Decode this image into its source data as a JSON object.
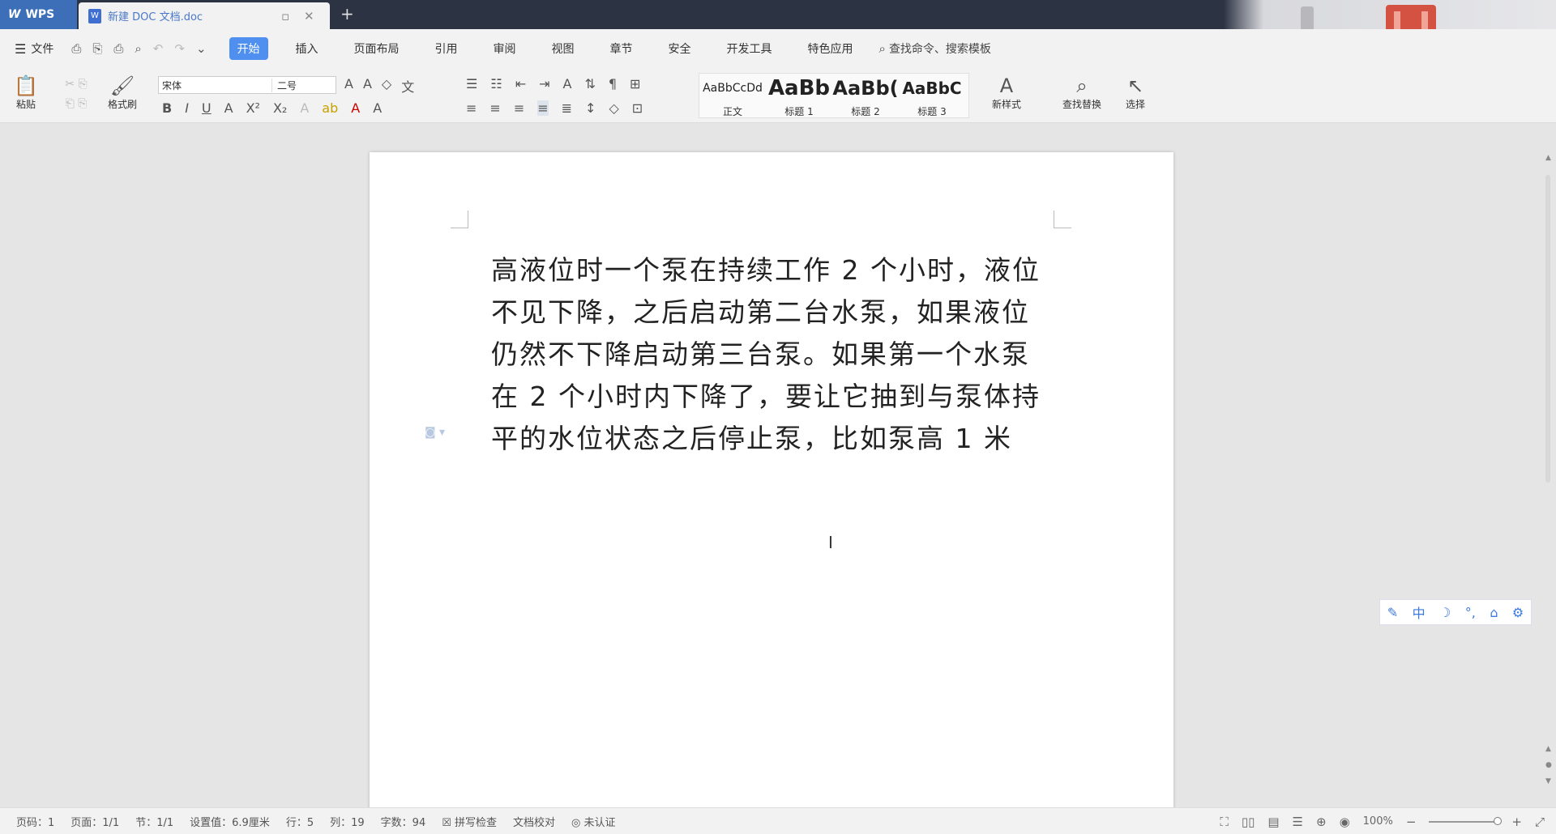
{
  "titlebar": {
    "app_name": "WPS",
    "doc_tab": "新建 DOC 文档.doc",
    "new_tab": "+"
  },
  "menubar": {
    "file_label": "文件",
    "tabs": [
      "开始",
      "插入",
      "页面布局",
      "引用",
      "审阅",
      "视图",
      "章节",
      "安全",
      "开发工具",
      "特色应用"
    ],
    "active_tab": "开始",
    "search_label": "查找命令、搜索模板"
  },
  "ribbon": {
    "paste_label": "粘贴",
    "format_painter_label": "格式刷",
    "font_name": "宋体",
    "font_size": "二号",
    "styles": [
      {
        "preview": "AaBbCcDd",
        "label": "正文"
      },
      {
        "preview": "AaBb",
        "label": "标题 1"
      },
      {
        "preview": "AaBb(",
        "label": "标题 2"
      },
      {
        "preview": "AaBbC",
        "label": "标题 3"
      }
    ],
    "new_style_label": "新样式",
    "find_replace_label": "查找替换",
    "select_label": "选择"
  },
  "document": {
    "lines": [
      "高液位时一个泵在持续工作 2 个小时，液位",
      "不见下降，之后启动第二台水泵，如果液位",
      "仍然不下降启动第三台泵。如果第一个水泵",
      "在 2 个小时内下降了，要让它抽到与泵体持",
      "平的水位状态之后停止泵，比如泵高 1 米"
    ]
  },
  "statusbar": {
    "page_num": "页码：1",
    "pages": "页面：1/1",
    "section": "节：1/1",
    "position": "设置值：6.9厘米",
    "row": "行：5",
    "col": "列：19",
    "word_count": "字数：94",
    "spell_check": "拼写检查",
    "doc_proof": "文档校对",
    "auth": "未认证",
    "zoom": "100%"
  },
  "colors": {
    "titlebar": "#2c3343",
    "wps_blue": "#3d6fb8",
    "active_tab": "#4f8ff0",
    "accent_red": "#d35242"
  }
}
